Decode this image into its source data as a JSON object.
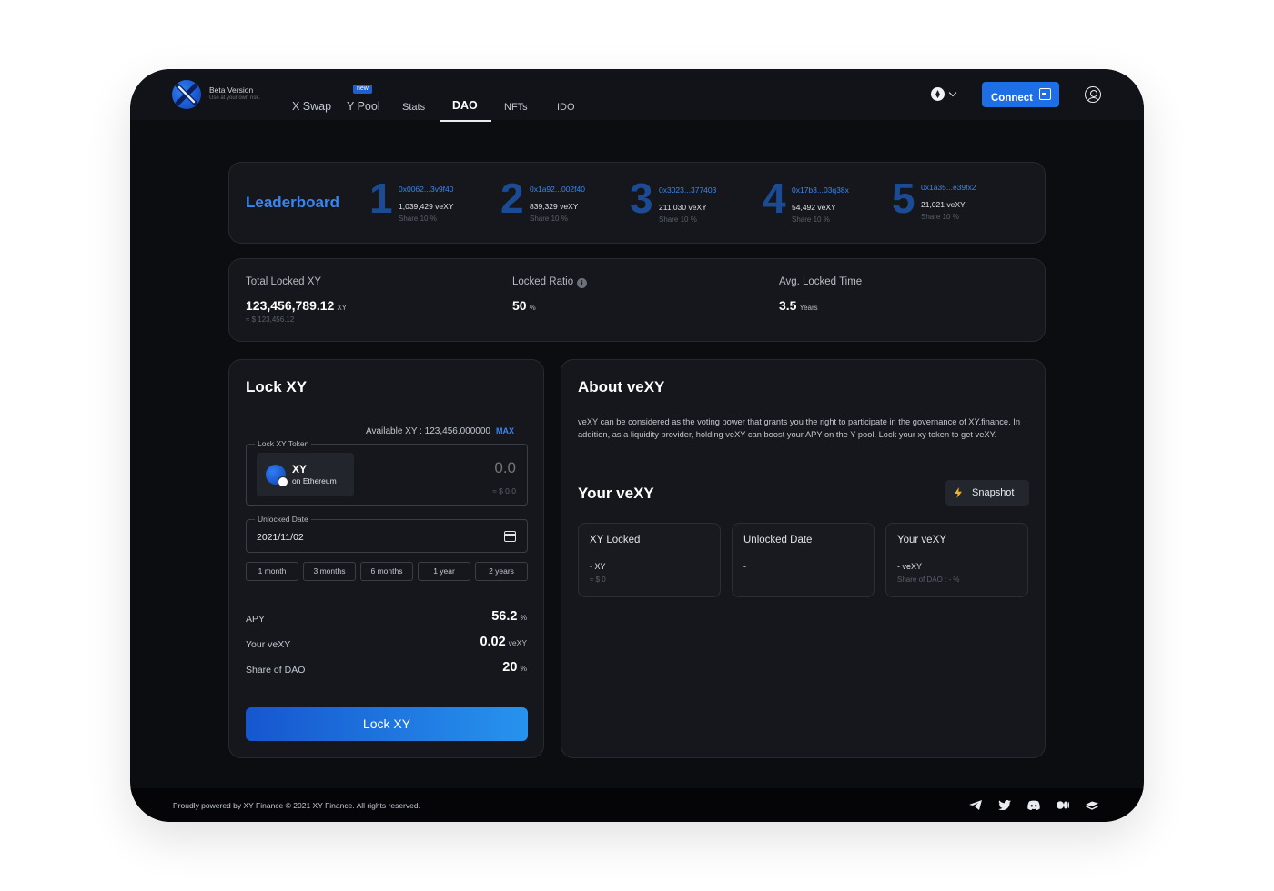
{
  "brand": {
    "title": "Beta Version",
    "subtitle": "Use at your own risk."
  },
  "nav": {
    "items": [
      "X Swap",
      "Y Pool",
      "Stats",
      "DAO",
      "NFTs",
      "IDO"
    ],
    "new_badge": "new",
    "active": "DAO"
  },
  "header": {
    "connect_label": "Connect",
    "icons": [
      "network-icon",
      "chevron-down-icon",
      "login-icon",
      "user-icon"
    ]
  },
  "leaderboard": {
    "title": "Leaderboard",
    "ranks": [
      {
        "num": "1",
        "address": "0x0062...3v9f40",
        "value": "1,039,429 veXY",
        "share": "Share 10 %"
      },
      {
        "num": "2",
        "address": "0x1a92...002f40",
        "value": "839,329 veXY",
        "share": "Share 10 %"
      },
      {
        "num": "3",
        "address": "0x3023...377403",
        "value": "211,030 veXY",
        "share": "Share 10 %"
      },
      {
        "num": "4",
        "address": "0x17b3...03q38x",
        "value": "54,492 veXY",
        "share": "Share 10 %"
      },
      {
        "num": "5",
        "address": "0x1a35...e39fx2",
        "value": "21,021 veXY",
        "share": "Share 10 %"
      }
    ]
  },
  "stats": {
    "total_locked": {
      "label": "Total Locked XY",
      "value": "123,456,789.12",
      "unit": "XY",
      "usd": "≈ $ 123,456.12"
    },
    "locked_ratio": {
      "label": "Locked Ratio",
      "value": "50",
      "unit": "%",
      "info": "i"
    },
    "avg_time": {
      "label": "Avg. Locked Time",
      "value": "3.5",
      "unit": "Years"
    }
  },
  "lock": {
    "title": "Lock XY",
    "available": "Available XY : 123,456.000000",
    "max": "MAX",
    "token_legend": "Lock XY Token",
    "token_name": "XY",
    "token_chain": "on Ethereum",
    "amount_placeholder": "0.0",
    "amount_usd": "≈ $ 0.0",
    "date_legend": "Unlocked Date",
    "date_value": "2021/11/02",
    "durations": [
      "1 month",
      "3 months",
      "6 months",
      "1 year",
      "2 years"
    ],
    "apy": {
      "label": "APY",
      "value": "56.2",
      "unit": "%"
    },
    "your_vexy": {
      "label": "Your veXY",
      "value": "0.02",
      "unit": "veXY"
    },
    "share": {
      "label": "Share of DAO",
      "value": "20",
      "unit": "%"
    },
    "button": "Lock XY"
  },
  "about": {
    "title": "About veXY",
    "text": "veXY can be considered as the voting power that grants you the right to participate in the governance of XY.finance. In addition, as a liquidity provider, holding veXY can boost your APY on the Y pool. Lock your xy token to get veXY.",
    "your_title": "Your veXY",
    "snapshot": "Snapshot",
    "cards": [
      {
        "title": "XY Locked",
        "value": "- XY",
        "sub": "≈ $ 0"
      },
      {
        "title": "Unlocked Date",
        "value": "-",
        "sub": ""
      },
      {
        "title": "Your veXY",
        "value": "- veXY",
        "sub": "Share of DAO : - %"
      }
    ]
  },
  "footer": {
    "text": "Proudly powered by XY Finance  © 2021 XY Finance. All rights reserved.",
    "socials": [
      "telegram-icon",
      "twitter-icon",
      "discord-icon",
      "medium-icon",
      "gitbook-icon"
    ]
  },
  "colors": {
    "accent": "#1e6fe6",
    "link": "#3a86f0",
    "bg": "#0c0d10",
    "panel": "#15171c"
  }
}
